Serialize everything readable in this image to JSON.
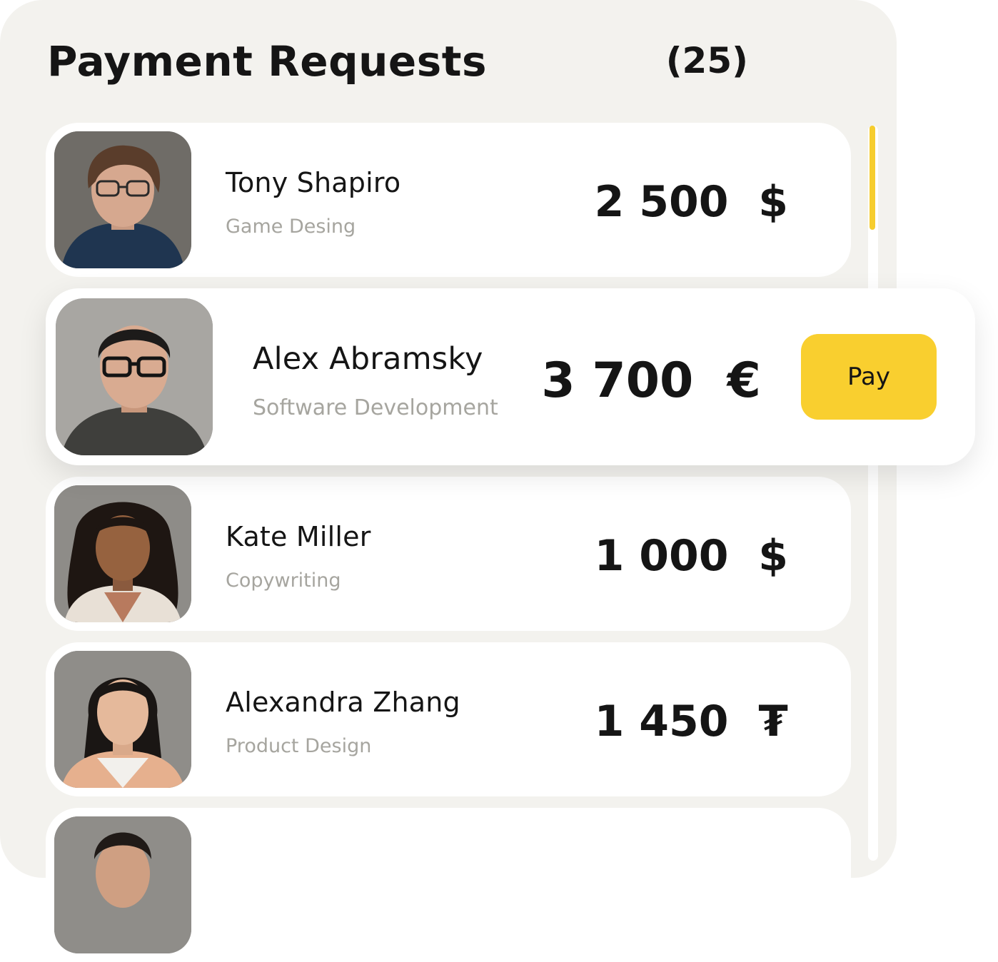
{
  "header": {
    "title": "Payment Requests",
    "count": "(25)"
  },
  "requests": [
    {
      "name": "Tony Shapiro",
      "role": "Game Desing",
      "amount": "2 500  $"
    },
    {
      "name": "Alex Abramsky",
      "role": "Software Development",
      "amount": "3 700  €",
      "action_label": "Pay"
    },
    {
      "name": "Kate Miller",
      "role": "Copywriting",
      "amount": "1 000  $"
    },
    {
      "name": "Alexandra Zhang",
      "role": "Product Design",
      "amount": "1 450  ₮"
    }
  ],
  "colors": {
    "accent": "#f9cf2f",
    "panel": "#f3f2ee",
    "text": "#151515",
    "muted": "#a6a59f"
  }
}
